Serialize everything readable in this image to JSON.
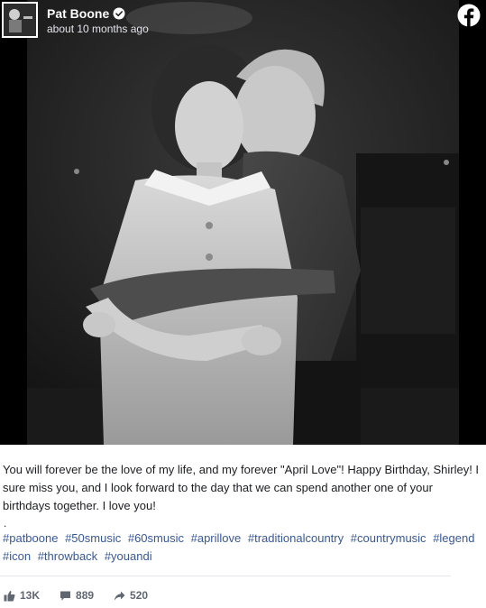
{
  "post": {
    "author": "Pat Boone",
    "timestamp": "about 10 months ago",
    "caption": "You will forever be the love of my life, and my forever \"April Love\"! Happy Birthday, Shirley! I sure miss you, and I look forward to the day that we can spend another one of your birthdays together. I love you!",
    "separator": ".",
    "hashtags": [
      "#patboone",
      "#50smusic",
      "#60smusic",
      "#aprillove",
      "#traditionalcountry",
      "#countrymusic",
      "#legend",
      "#icon",
      "#throwback",
      "#youandi"
    ]
  },
  "stats": {
    "likes": "13K",
    "comments": "889",
    "shares": "520"
  },
  "icons": {
    "brand": "facebook-logo-icon",
    "verified": "verified-badge-icon",
    "like": "thumbs-up-icon",
    "comment": "comment-icon",
    "share": "share-arrow-icon"
  },
  "colors": {
    "facebook_white": "#ffffff",
    "hashtag_link": "#385898",
    "stats_gray": "#606770"
  }
}
